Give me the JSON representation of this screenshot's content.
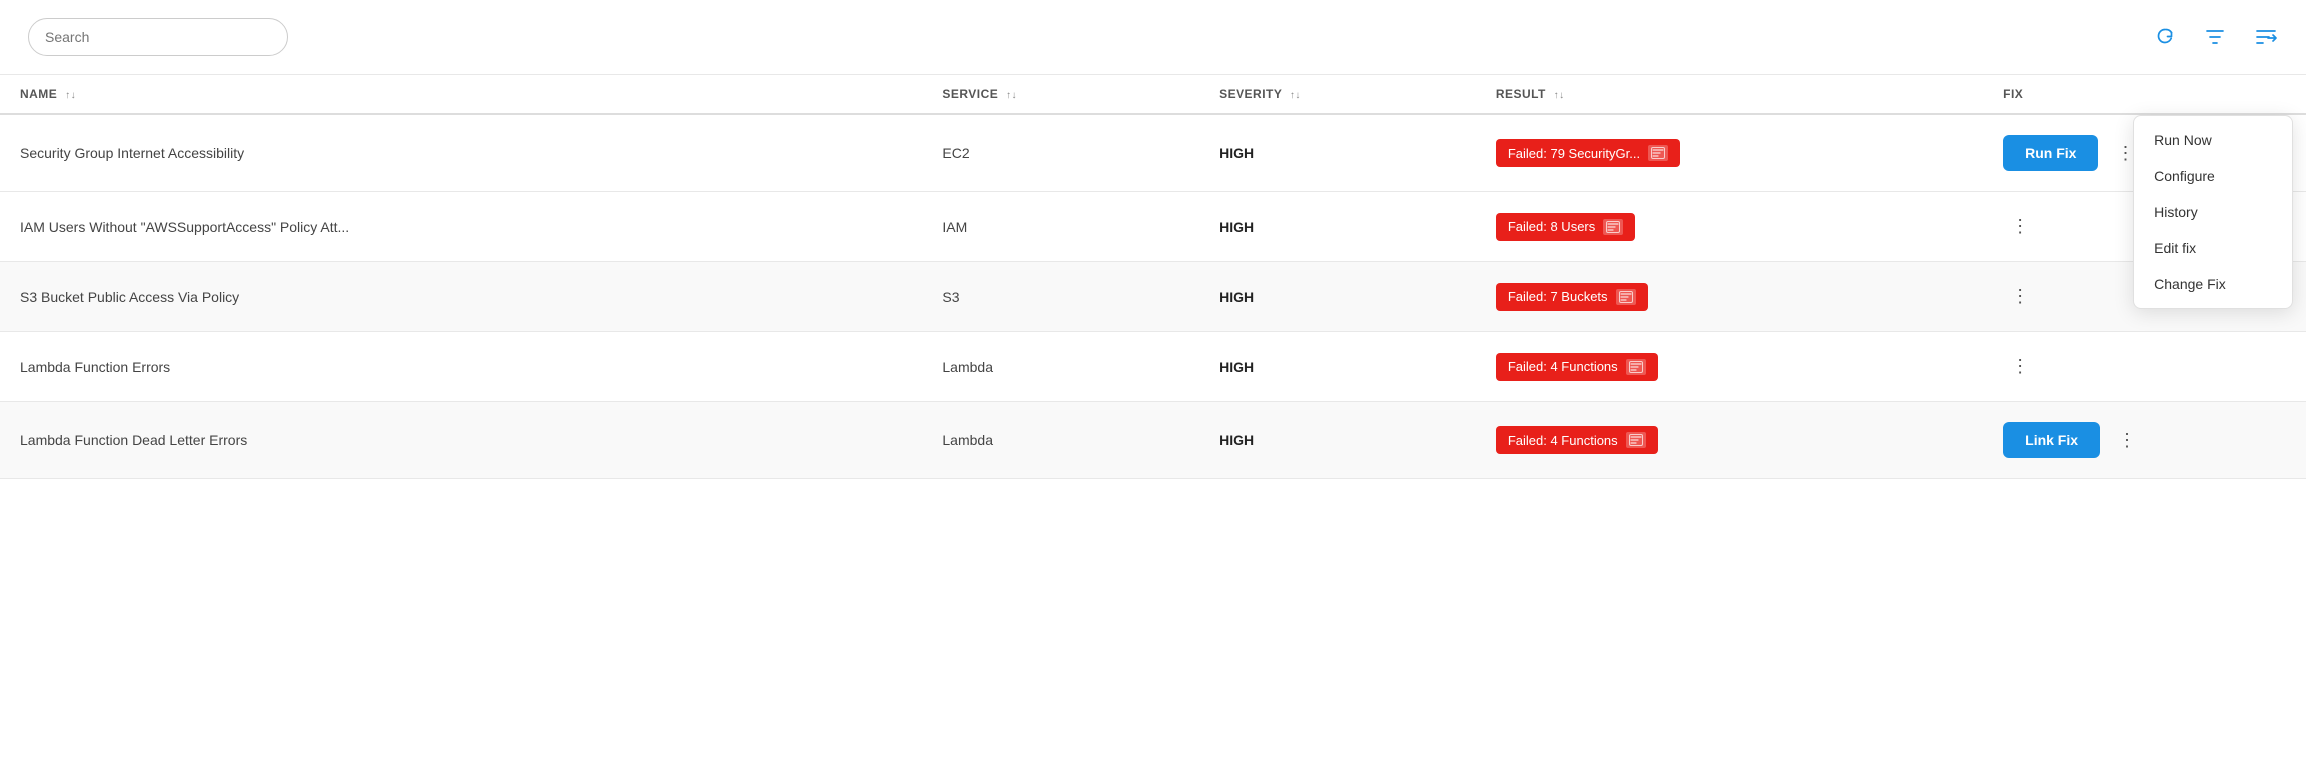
{
  "header": {
    "search_placeholder": "Search",
    "icons": {
      "refresh": "↻",
      "filter": "⛉",
      "list": "≡"
    }
  },
  "table": {
    "columns": [
      {
        "key": "name",
        "label": "NAME",
        "sortable": true
      },
      {
        "key": "service",
        "label": "SERVICE",
        "sortable": true
      },
      {
        "key": "severity",
        "label": "SEVERITY",
        "sortable": true
      },
      {
        "key": "result",
        "label": "RESULT",
        "sortable": true
      },
      {
        "key": "fix",
        "label": "FIX",
        "sortable": false
      }
    ],
    "rows": [
      {
        "name": "Security Group Internet Accessibility",
        "service": "EC2",
        "severity": "HIGH",
        "result_text": "Failed: 79 SecurityGr...",
        "fix_type": "run_fix",
        "fix_label": "Run Fix",
        "show_dropdown": true
      },
      {
        "name": "IAM Users Without \"AWSSupportAccess\" Policy Att...",
        "service": "IAM",
        "severity": "HIGH",
        "result_text": "Failed: 8 Users",
        "fix_type": "none",
        "fix_label": "",
        "show_dropdown": true
      },
      {
        "name": "S3 Bucket Public Access Via Policy",
        "service": "S3",
        "severity": "HIGH",
        "result_text": "Failed: 7 Buckets",
        "fix_type": "none",
        "fix_label": "",
        "show_dropdown": true
      },
      {
        "name": "Lambda Function Errors",
        "service": "Lambda",
        "severity": "HIGH",
        "result_text": "Failed: 4 Functions",
        "fix_type": "none",
        "fix_label": "",
        "show_dropdown": true
      },
      {
        "name": "Lambda Function Dead Letter Errors",
        "service": "Lambda",
        "severity": "HIGH",
        "result_text": "Failed: 4 Functions",
        "fix_type": "link_fix",
        "fix_label": "Link Fix",
        "show_dropdown": true
      }
    ],
    "dropdown_items": [
      {
        "key": "run_now",
        "label": "Run Now"
      },
      {
        "key": "configure",
        "label": "Configure"
      },
      {
        "key": "history",
        "label": "History"
      },
      {
        "key": "edit_fix",
        "label": "Edit fix"
      },
      {
        "key": "change_fix",
        "label": "Change Fix"
      }
    ]
  }
}
